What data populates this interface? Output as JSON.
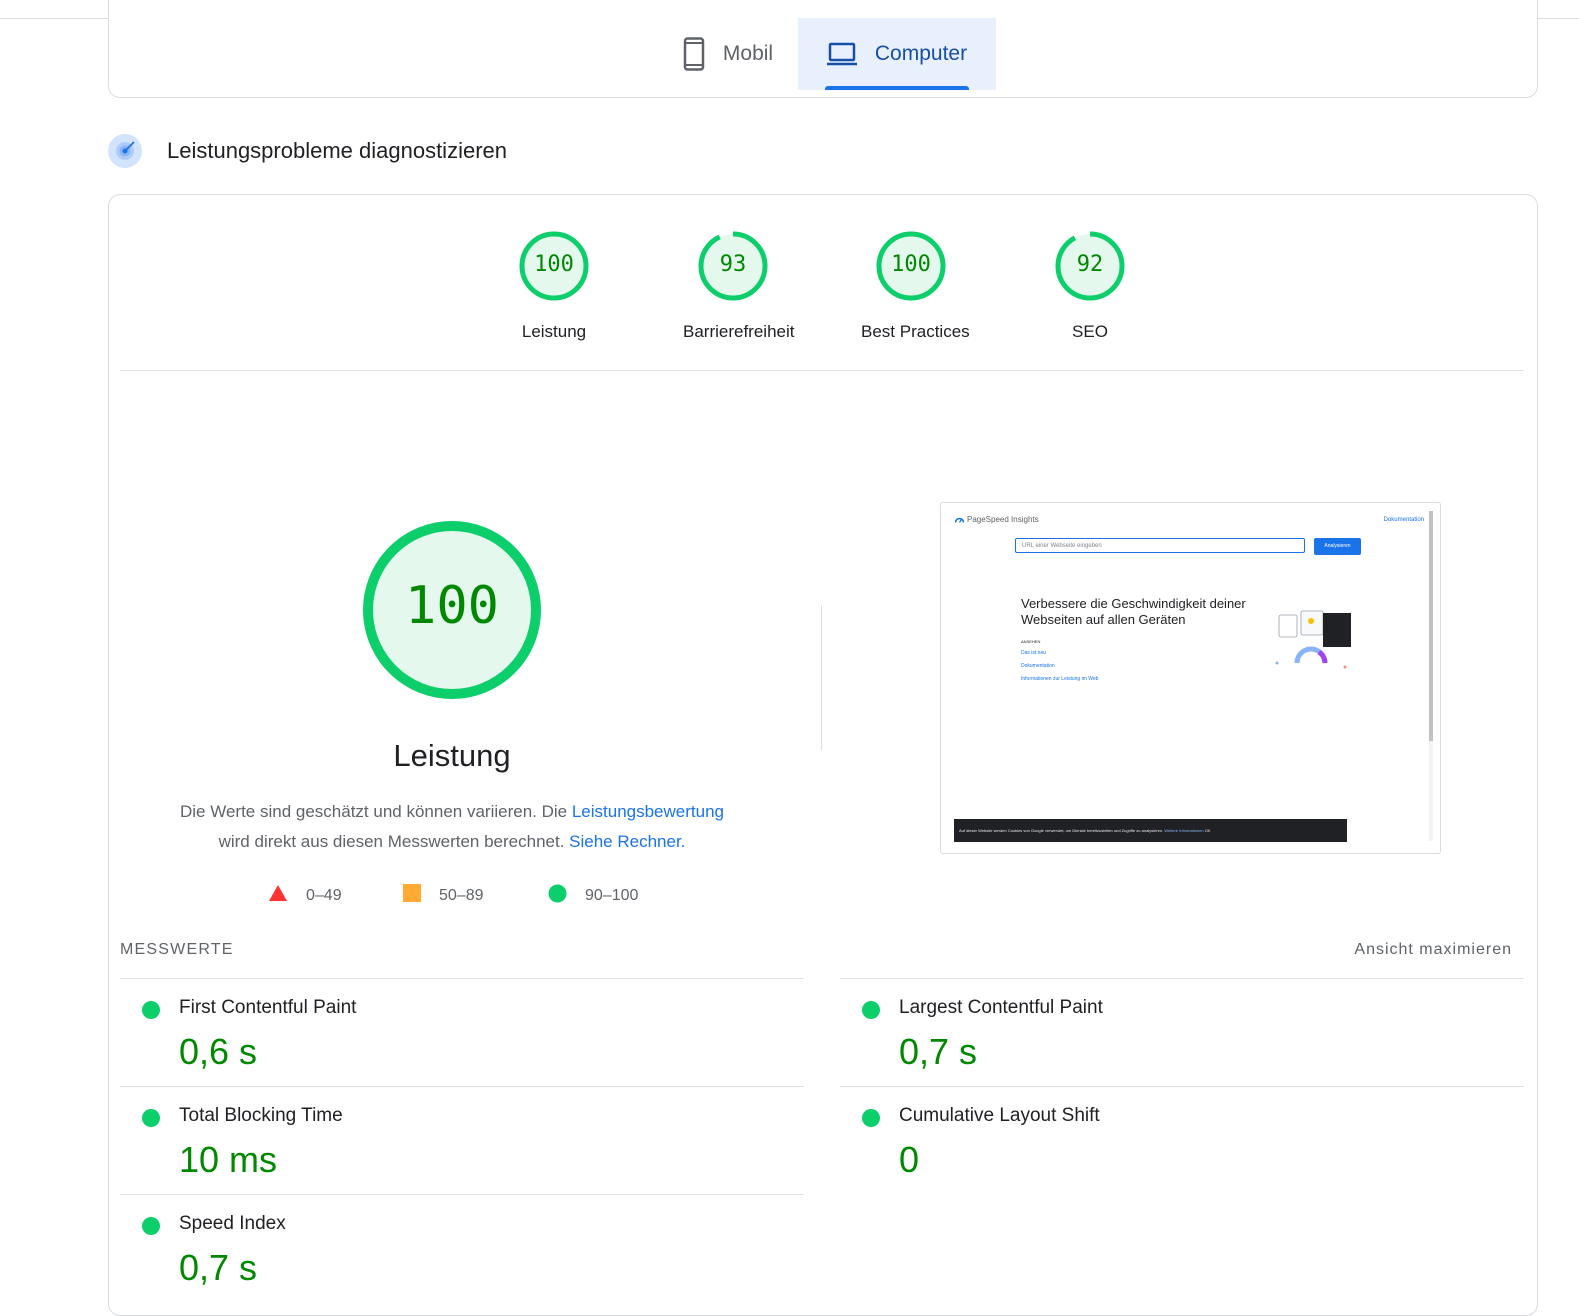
{
  "device_tabs": {
    "mobile_label": "Mobil",
    "desktop_label": "Computer",
    "active": "Computer"
  },
  "section": {
    "title": "Leistungsprobleme diagnostizieren",
    "icon": "diagnostics-target-icon"
  },
  "categories": [
    {
      "score": "100",
      "label": "Leistung",
      "fraction": 1.0
    },
    {
      "score": "93",
      "label": "Barrierefreiheit",
      "fraction": 0.93
    },
    {
      "score": "100",
      "label": "Best Practices",
      "fraction": 1.0
    },
    {
      "score": "92",
      "label": "SEO",
      "fraction": 0.92
    }
  ],
  "performance": {
    "score": "100",
    "title": "Leistung",
    "desc_part1": "Die Werte sind geschätzt und können variieren. Die ",
    "desc_link1": "Leistungsbewertung",
    "desc_part2": "wird direkt aus diesen Messwerten berechnet. ",
    "desc_link2": "Siehe Rechner."
  },
  "legend": [
    {
      "range": "0–49",
      "shape": "triangle",
      "color": "#ff3333"
    },
    {
      "range": "50–89",
      "shape": "square",
      "color": "#ffaa33"
    },
    {
      "range": "90–100",
      "shape": "circle",
      "color": "#0cce6b"
    }
  ],
  "screenshot": {
    "brand": "PageSpeed Insights",
    "doc_link": "Dokumentation",
    "input_placeholder": "URL einer Webseite eingeben",
    "button": "Analysieren",
    "headline": "Verbessere die Geschwindigkeit deiner Webseiten auf allen Geräten",
    "small_label": "ANSEHEN",
    "links": [
      "Das ist neu",
      "Dokumentation",
      "Informationen zur Leistung im Web"
    ],
    "cookie_text": "Auf dieser Website werden Cookies von Google verwendet, um Dienste bereitzustellen und Zugriffe zu analysieren.",
    "cookie_more": "Weitere Informationen",
    "cookie_ok": "OK"
  },
  "metrics_header": {
    "title": "MESSWERTE",
    "expand_label": "Ansicht maximieren"
  },
  "metrics": [
    {
      "label": "First Contentful Paint",
      "value": "0,6 s"
    },
    {
      "label": "Largest Contentful Paint",
      "value": "0,7 s"
    },
    {
      "label": "Total Blocking Time",
      "value": "10 ms"
    },
    {
      "label": "Cumulative Layout Shift",
      "value": "0"
    },
    {
      "label": "Speed Index",
      "value": "0,7 s"
    }
  ],
  "colors": {
    "pass": "#0cce6b",
    "pass_text": "#008800",
    "pass_bg": "#e5f8ee",
    "accent": "#1a73e8"
  }
}
